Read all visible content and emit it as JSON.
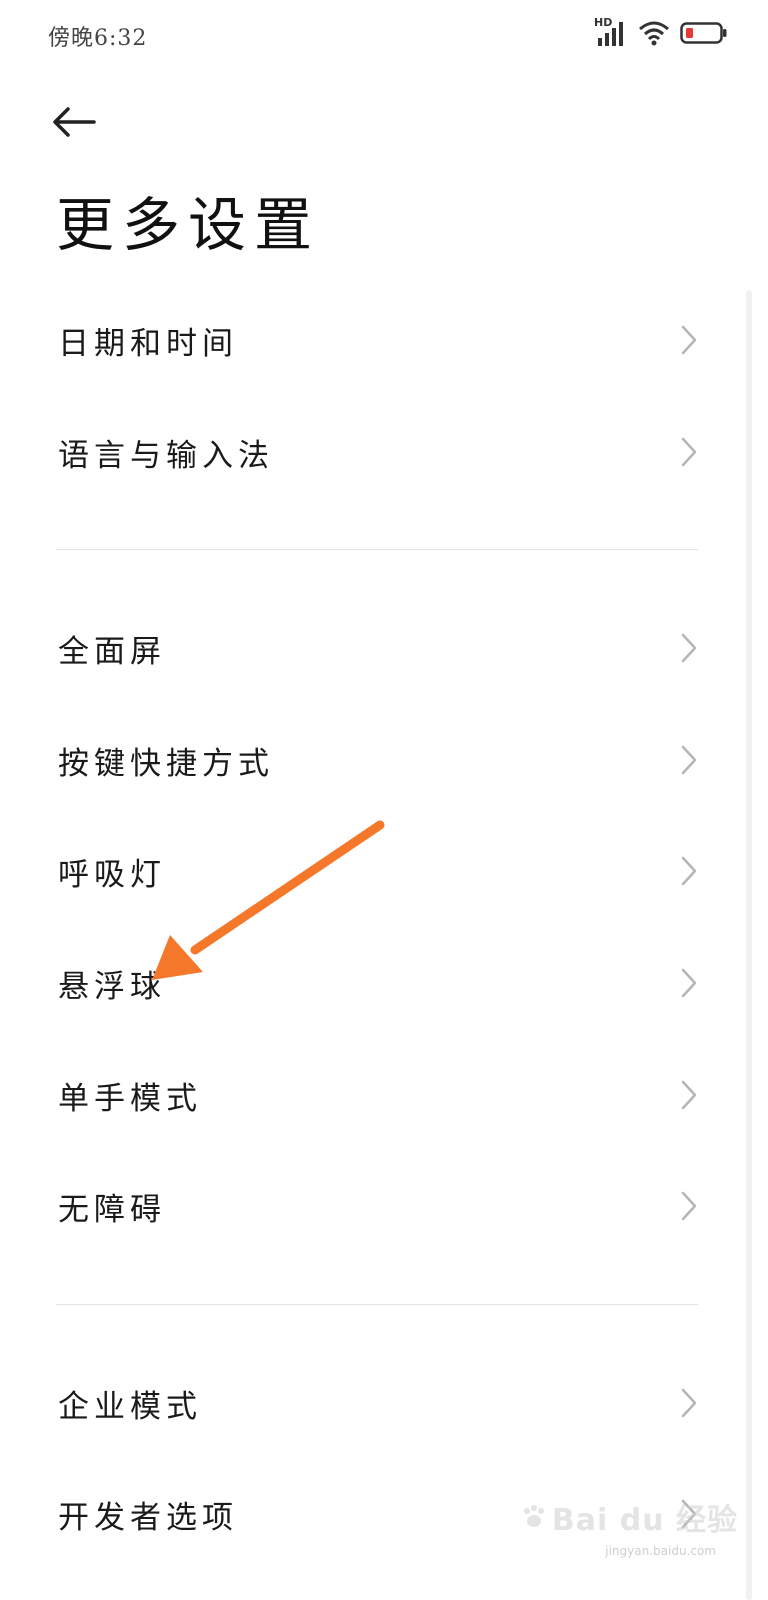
{
  "status_bar": {
    "time": "傍晚6:32",
    "network_label": "HD",
    "battery_color": "#e53935"
  },
  "header": {
    "back_icon": "arrow-left-icon",
    "title": "更多设置"
  },
  "settings": {
    "group1": [
      {
        "label": "日期和时间"
      },
      {
        "label": "语言与输入法"
      }
    ],
    "group2": [
      {
        "label": "全面屏"
      },
      {
        "label": "按键快捷方式"
      },
      {
        "label": "呼吸灯"
      },
      {
        "label": "悬浮球"
      },
      {
        "label": "单手模式"
      },
      {
        "label": "无障碍"
      }
    ],
    "group3": [
      {
        "label": "企业模式"
      },
      {
        "label": "开发者选项"
      }
    ]
  },
  "annotation": {
    "arrow_color": "#f5782a",
    "target": "悬浮球"
  },
  "watermark": {
    "brand": "Bai du 经验",
    "url": "jingyan.baidu.com"
  }
}
